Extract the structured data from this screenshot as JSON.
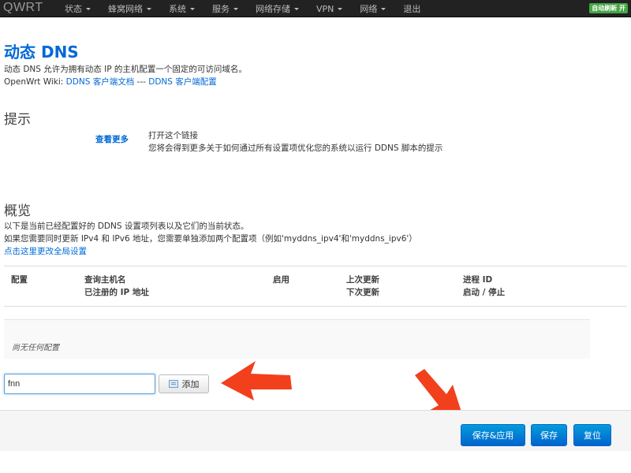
{
  "navbar": {
    "brand": "QWRT",
    "menu": [
      {
        "label": "状态",
        "has_caret": true
      },
      {
        "label": "蜂窝网络",
        "has_caret": true
      },
      {
        "label": "系统",
        "has_caret": true
      },
      {
        "label": "服务",
        "has_caret": true
      },
      {
        "label": "网络存储",
        "has_caret": true
      },
      {
        "label": "VPN",
        "has_caret": true
      },
      {
        "label": "网络",
        "has_caret": true
      },
      {
        "label": "退出",
        "has_caret": false
      }
    ],
    "refresh_badge": "自动刷新 开"
  },
  "page": {
    "title": "动态 DNS",
    "description": "动态 DNS 允许为拥有动态 IP 的主机配置一个固定的可访问域名。",
    "wiki_prefix": "OpenWrt Wiki: ",
    "wiki_link1": "DDNS 客户端文档",
    "wiki_sep": " --- ",
    "wiki_link2": "DDNS 客户端配置"
  },
  "hint": {
    "title": "提示",
    "link": "查看更多",
    "line1": "打开这个链接",
    "line2": "您将会得到更多关于如何通过所有设置项优化您的系统以运行 DDNS 脚本的提示"
  },
  "overview": {
    "title": "概览",
    "line1": "以下是当前已经配置好的 DDNS 设置项列表以及它们的当前状态。",
    "line2": "如果您需要同时更新 IPv4 和 IPv6 地址，您需要单独添加两个配置项（例如'myddns_ipv4'和'myddns_ipv6'）",
    "global_link": "点击这里更改全局设置"
  },
  "table": {
    "col_config": "配置",
    "col_host_1": "查询主机名",
    "col_host_2": "已注册的 IP 地址",
    "col_enabled": "启用",
    "col_update_1": "上次更新",
    "col_update_2": "下次更新",
    "col_pid_1": "进程 ID",
    "col_pid_2": "启动 / 停止",
    "empty": "尚无任何配置"
  },
  "add": {
    "input_value": "fnn",
    "button": "添加"
  },
  "actions": {
    "save_apply": "保存&应用",
    "save": "保存",
    "reset": "复位"
  },
  "colors": {
    "accent": "#0069d6",
    "arrow": "#f2401d",
    "badge": "#46a546"
  }
}
